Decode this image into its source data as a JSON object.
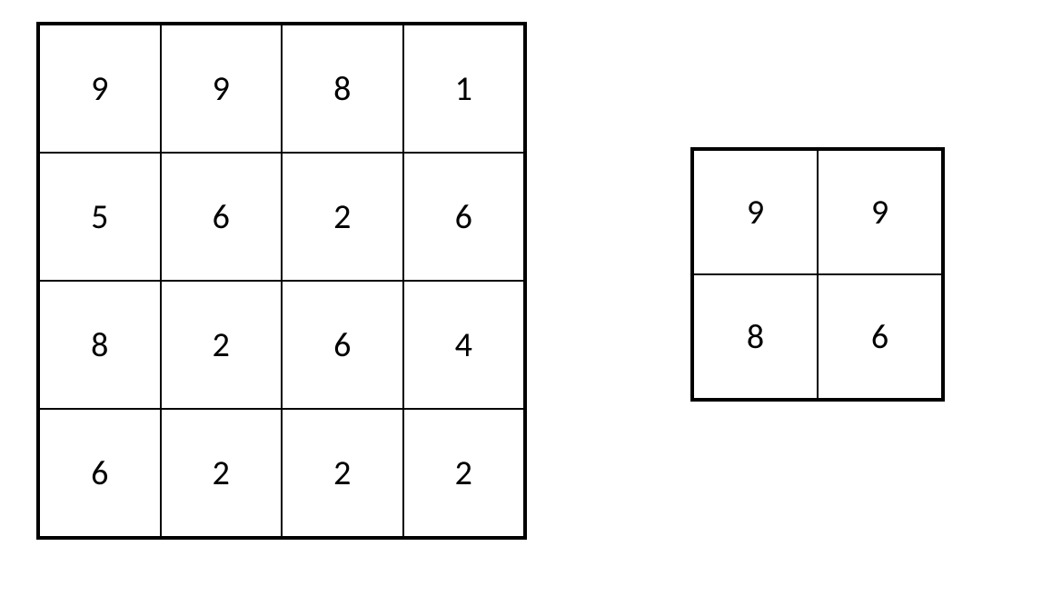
{
  "grids": {
    "large": {
      "rows": 4,
      "cols": 4,
      "cells": [
        [
          "9",
          "9",
          "8",
          "1"
        ],
        [
          "5",
          "6",
          "2",
          "6"
        ],
        [
          "8",
          "2",
          "6",
          "4"
        ],
        [
          "6",
          "2",
          "2",
          "2"
        ]
      ]
    },
    "small": {
      "rows": 2,
      "cols": 2,
      "cells": [
        [
          "9",
          "9"
        ],
        [
          "8",
          "6"
        ]
      ]
    }
  }
}
